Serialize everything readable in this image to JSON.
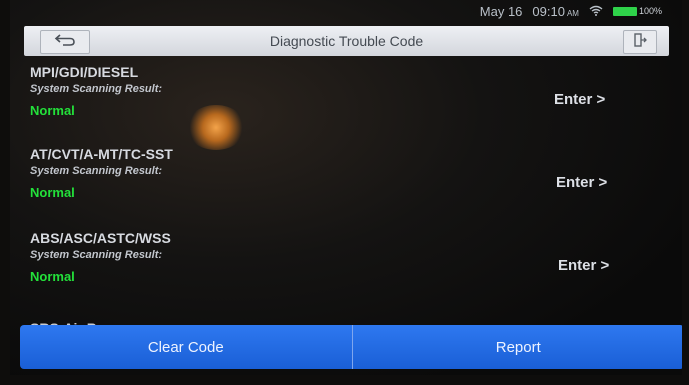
{
  "status_bar": {
    "date": "May 16",
    "time": "09:10",
    "ampm": "AM",
    "battery": "100%"
  },
  "header": {
    "title": "Diagnostic Trouble Code",
    "back_icon": "back-arrow-icon",
    "exit_icon": "exit-icon"
  },
  "systems": [
    {
      "name": "MPI/GDI/DIESEL",
      "label": "System Scanning Result:",
      "status": "Normal",
      "action": "Enter >"
    },
    {
      "name": "AT/CVT/A-MT/TC-SST",
      "label": "System Scanning Result:",
      "status": "Normal",
      "action": "Enter >"
    },
    {
      "name": "ABS/ASC/ASTC/WSS",
      "label": "System Scanning Result:",
      "status": "Normal",
      "action": "Enter >"
    }
  ],
  "partial_item": "SRS-Air Bag",
  "footer": {
    "clear_code": "Clear Code",
    "report": "Report"
  },
  "colors": {
    "accent_blue": "#2e78f0",
    "status_normal": "#23e03a",
    "battery": "#2fd24a"
  }
}
